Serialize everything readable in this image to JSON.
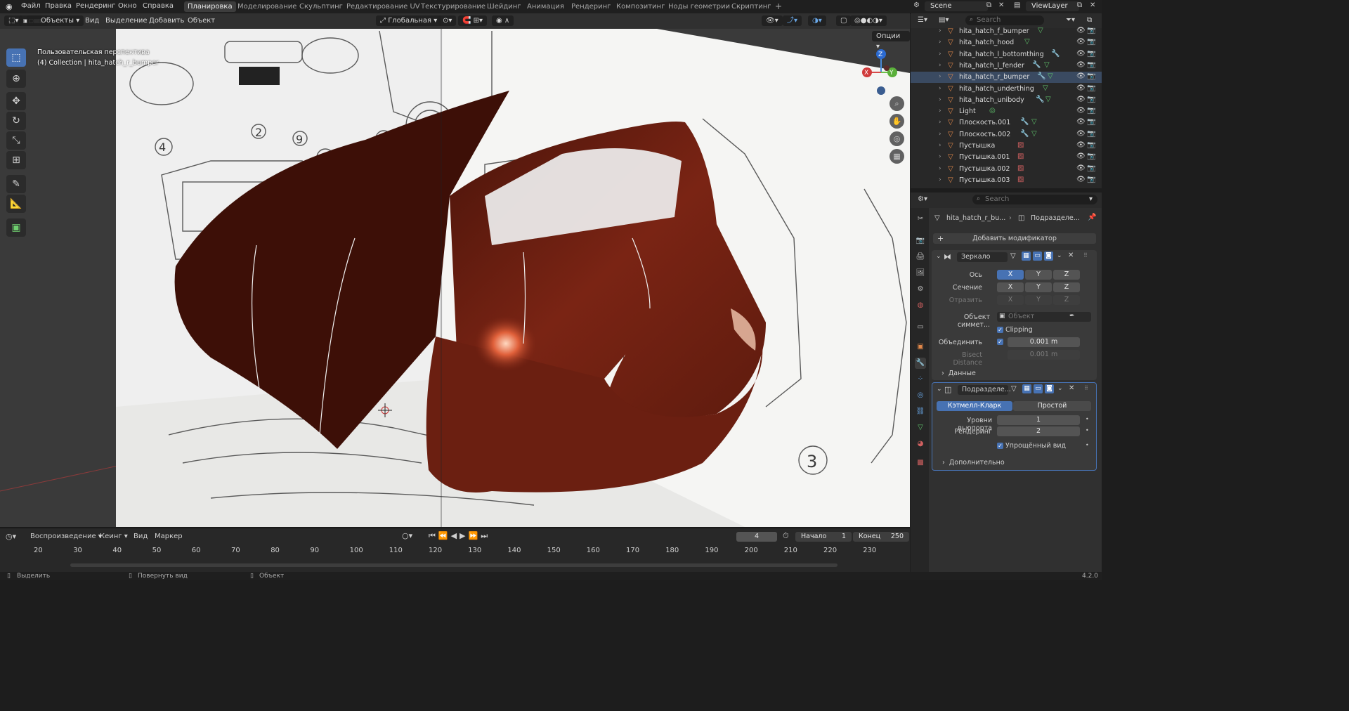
{
  "topbar": {
    "menus": [
      "Файл",
      "Правка",
      "Рендеринг",
      "Окно",
      "Справка"
    ],
    "workspaces": [
      "Планировка",
      "Моделирование",
      "Скульптинг",
      "Редактирование UV",
      "Текстурирование",
      "Шейдинг",
      "Анимация",
      "Рендеринг",
      "Композитинг",
      "Ноды геометрии",
      "Скриптинг"
    ],
    "active_workspace": "Планировка",
    "add_tab": "+",
    "scene": "Scene",
    "view_layer": "ViewLayer"
  },
  "viewport_header": {
    "mode": "Объекты",
    "menus": [
      "Вид",
      "Выделение",
      "Добавить",
      "Объект"
    ],
    "orientation": "Глобальная",
    "options": "Опции"
  },
  "viewport": {
    "view_name": "Пользовательская перспектива",
    "collection_info": "(4) Collection | hita_hatch_r_bumper",
    "gizmo": {
      "x": "X",
      "y": "Y",
      "z": "Z"
    }
  },
  "outliner": {
    "search_placeholder": "Search",
    "items": [
      {
        "name": "hita_hatch_f_bumper",
        "selected": false,
        "mod": false,
        "mesh": true
      },
      {
        "name": "hita_hatch_hood",
        "selected": false,
        "mod": false,
        "mesh": true
      },
      {
        "name": "hita_hatch_l_bottomthing",
        "selected": false,
        "mod": true,
        "mesh": false
      },
      {
        "name": "hita_hatch_l_fender",
        "selected": false,
        "mod": true,
        "mesh": true
      },
      {
        "name": "hita_hatch_r_bumper",
        "selected": true,
        "mod": true,
        "mesh": true
      },
      {
        "name": "hita_hatch_underthing",
        "selected": false,
        "mod": false,
        "mesh": true
      },
      {
        "name": "hita_hatch_unibody",
        "selected": false,
        "mod": true,
        "mesh": true
      },
      {
        "name": "Light",
        "selected": false,
        "mod": false,
        "mesh": false
      },
      {
        "name": "Плоскость.001",
        "selected": false,
        "mod": true,
        "mesh": true
      },
      {
        "name": "Плоскость.002",
        "selected": false,
        "mod": true,
        "mesh": true
      },
      {
        "name": "Пустышка",
        "selected": false,
        "mod": false,
        "mesh": false
      },
      {
        "name": "Пустышка.001",
        "selected": false,
        "mod": false,
        "mesh": false
      },
      {
        "name": "Пустышка.002",
        "selected": false,
        "mod": false,
        "mesh": false
      },
      {
        "name": "Пустышка.003",
        "selected": false,
        "mod": false,
        "mesh": false
      }
    ]
  },
  "properties": {
    "search_placeholder": "Search",
    "breadcrumb_object": "hita_hatch_r_bu...",
    "breadcrumb_modifier": "Подразделе...",
    "add_modifier": "Добавить модификатор",
    "mirror": {
      "name": "Зеркало",
      "axis_label": "Ось",
      "bisect_label": "Сечение",
      "flip_label": "Отразить",
      "x": "X",
      "y": "Y",
      "z": "Z",
      "mirror_object_label": "Объект симмет...",
      "mirror_object_placeholder": "Объект",
      "clipping": "Clipping",
      "merge_label": "Объединить",
      "merge_value": "0.001 m",
      "bisect_distance_label": "Bisect Distance",
      "bisect_distance_value": "0.001 m",
      "data_section": "Данные"
    },
    "subdivision": {
      "name": "Подразделе...",
      "catmull": "Кэтмелл-Кларк",
      "simple": "Простой",
      "levels_viewport_label": "Уровни вьюпорта",
      "levels_viewport_value": "1",
      "render_label": "Рендеринг",
      "render_value": "2",
      "optimal_display": "Упрощённый вид",
      "advanced_section": "Дополнительно"
    }
  },
  "timeline": {
    "menus": [
      "Воспроизведение",
      "Кеинг",
      "Вид",
      "Маркер"
    ],
    "current_frame": "4",
    "start_label": "Начало",
    "start_value": "1",
    "end_label": "Конец",
    "end_value": "250",
    "ticks": [
      "20",
      "30",
      "40",
      "50",
      "60",
      "70",
      "80",
      "90",
      "100",
      "110",
      "120",
      "130",
      "140",
      "150",
      "160",
      "170",
      "180",
      "190",
      "200",
      "210",
      "220",
      "230"
    ]
  },
  "statusbar": {
    "select": "Выделить",
    "rotate": "Повернуть вид",
    "object": "Объект",
    "version": "4.2.0"
  },
  "colors": {
    "accent": "#4772b3",
    "car_body": "#7a2414",
    "background": "#303030"
  }
}
